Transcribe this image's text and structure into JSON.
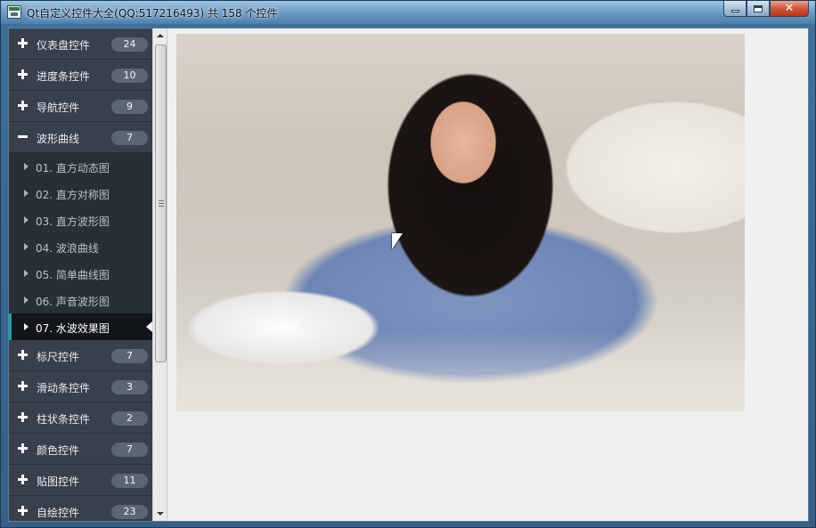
{
  "window": {
    "title": "Qt自定义控件大全(QQ:517216493) 共 158 个控件",
    "icon": "app-window-icon",
    "buttons": {
      "minimize": "minimize-icon",
      "maximize": "maximize-icon",
      "close": "close-icon",
      "close_glyph": "✕"
    }
  },
  "nav": {
    "top_groups": [
      {
        "label": "仪表盘控件",
        "count": "24",
        "icon": "plus-icon"
      },
      {
        "label": "进度条控件",
        "count": "10",
        "icon": "plus-icon"
      },
      {
        "label": "导航控件",
        "count": "9",
        "icon": "plus-icon"
      },
      {
        "label": "波形曲线",
        "count": "7",
        "icon": "minus-icon"
      }
    ],
    "children": [
      {
        "label": "01. 直方动态图",
        "active": false
      },
      {
        "label": "02. 直方对称图",
        "active": false
      },
      {
        "label": "03. 直方波形图",
        "active": false
      },
      {
        "label": "04. 波浪曲线",
        "active": false
      },
      {
        "label": "05. 简单曲线图",
        "active": false
      },
      {
        "label": "06. 声音波形图",
        "active": false
      },
      {
        "label": "07. 水波效果图",
        "active": true
      }
    ],
    "bottom_groups": [
      {
        "label": "标尺控件",
        "count": "7",
        "icon": "plus-icon"
      },
      {
        "label": "滑动条控件",
        "count": "3",
        "icon": "plus-icon"
      },
      {
        "label": "柱状条控件",
        "count": "2",
        "icon": "plus-icon"
      },
      {
        "label": "颜色控件",
        "count": "7",
        "icon": "plus-icon"
      },
      {
        "label": "贴图控件",
        "count": "11",
        "icon": "plus-icon"
      },
      {
        "label": "自绘控件",
        "count": "23",
        "icon": "plus-icon"
      }
    ]
  },
  "colors": {
    "nav_background": "#292f38",
    "group_background": "#39404b",
    "active_background": "#12151a",
    "active_accent": "#1aa3a3",
    "badge": "#5b6674"
  },
  "main": {
    "image": "water-ripple-photo"
  }
}
